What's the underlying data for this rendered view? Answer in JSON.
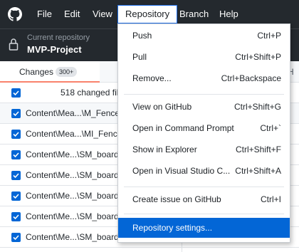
{
  "menubar": {
    "logo_icon": "github-icon",
    "items": [
      "File",
      "Edit",
      "View",
      "Repository",
      "Branch",
      "Help"
    ],
    "active_item": "Repository"
  },
  "repo": {
    "caption": "Current repository",
    "name": "MVP-Project",
    "icon": "lock-icon"
  },
  "tabs": {
    "changes_label": "Changes",
    "changes_count": "300+",
    "history_stub": "H"
  },
  "changes": {
    "summary": "518 changed fil",
    "files": [
      "Content\\Mea...\\M_Fence",
      "Content\\Mea...\\MI_Fence",
      "Content\\Me...\\SM_board",
      "Content\\Me...\\SM_board",
      "Content\\Me...\\SM_board",
      "Content\\Me...\\SM_board",
      "Content\\Me...\\SM_board"
    ]
  },
  "dropdown": {
    "items": [
      {
        "label": "Push",
        "shortcut": "Ctrl+P"
      },
      {
        "label": "Pull",
        "shortcut": "Ctrl+Shift+P"
      },
      {
        "label": "Remove...",
        "shortcut": "Ctrl+Backspace"
      },
      {
        "label": "View on GitHub",
        "shortcut": "Ctrl+Shift+G"
      },
      {
        "label": "Open in Command Prompt",
        "shortcut": "Ctrl+`"
      },
      {
        "label": "Show in Explorer",
        "shortcut": "Ctrl+Shift+F"
      },
      {
        "label": "Open in Visual Studio C...",
        "shortcut": "Ctrl+Shift+A"
      },
      {
        "label": "Create issue on GitHub",
        "shortcut": "Ctrl+I"
      },
      {
        "label": "Repository settings...",
        "shortcut": ""
      }
    ]
  },
  "colors": {
    "menubar_bg": "#24292e",
    "highlight": "#0366d6",
    "tab_accent": "#f9826c"
  }
}
